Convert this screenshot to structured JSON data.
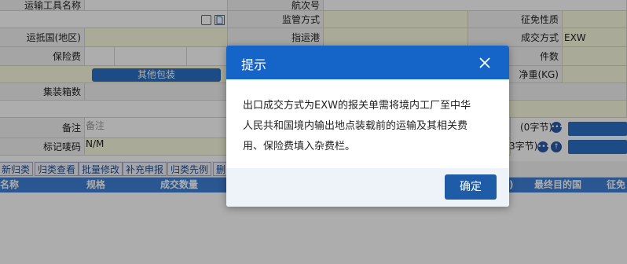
{
  "form": {
    "transport_name_label": "运输工具名称",
    "voyage_label": "航次号",
    "supervision_label": "监管方式",
    "tax_nature_label": "征免性质",
    "dest_country_label": "运抵国(地区)",
    "port_label": "指运港",
    "deal_mode_label": "成交方式",
    "deal_mode_value": "EXW",
    "insurance_label": "保险费",
    "pieces_label": "件数",
    "other_pack_button": "其他包装",
    "net_weight_label": "净重(KG)",
    "container_label": "集装箱数",
    "remark_label": "备注",
    "remark_placeholder": "备注",
    "remark_count": "(0字节)",
    "mark_label": "标记唛码",
    "mark_value": "N/M",
    "mark_count": "3字节)"
  },
  "toolbar": {
    "buttons": [
      "新归类",
      "归类查看",
      "批量修改",
      "补充申报",
      "归类先例",
      "删"
    ]
  },
  "table": {
    "headers": [
      "名称",
      "规格",
      "成交数量",
      ")",
      "最终目的国",
      "征免"
    ]
  },
  "modal": {
    "title": "提示",
    "message": "出口成交方式为EXW的报关单需将境内工厂至中华\n人民共和国境内输出地点装载前的运输及其相关费\n用、保险费填入杂费栏。",
    "ok_label": "确定"
  },
  "colors": {
    "modal_header": "#1565c8",
    "ok_button": "#1f5ca8",
    "table_header": "#3f7fd6",
    "input_yellow": "#fbfbe0"
  }
}
